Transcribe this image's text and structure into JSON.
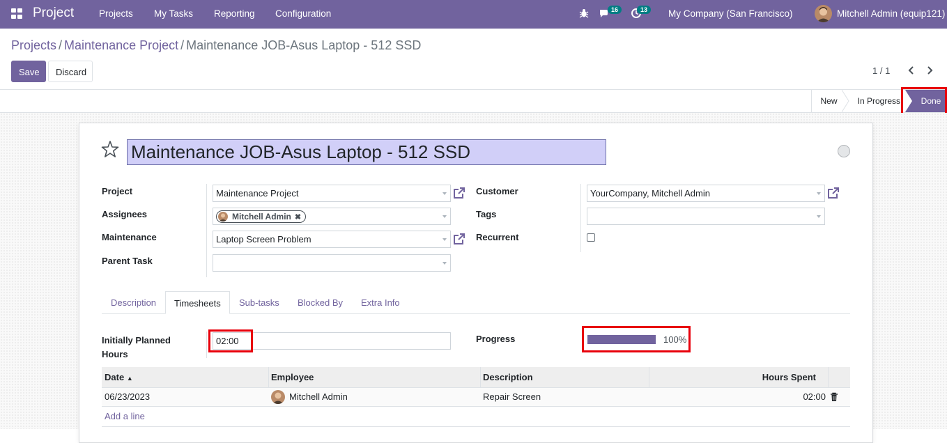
{
  "navbar": {
    "app_title": "Project",
    "menu": [
      "Projects",
      "My Tasks",
      "Reporting",
      "Configuration"
    ],
    "messages_count": "16",
    "activities_count": "13",
    "company": "My Company (San Francisco)",
    "user": "Mitchell Admin (equip121)"
  },
  "breadcrumb": {
    "items": [
      "Projects",
      "Maintenance Project"
    ],
    "current": "Maintenance JOB-Asus Laptop - 512 SSD"
  },
  "buttons": {
    "save": "Save",
    "discard": "Discard"
  },
  "pager": {
    "value": "1 / 1"
  },
  "stages": {
    "new": "New",
    "in_progress": "In Progress",
    "done": "Done",
    "active": "Done"
  },
  "task": {
    "title": "Maintenance JOB-Asus Laptop - 512 SSD",
    "fields": {
      "project_label": "Project",
      "project_value": "Maintenance Project",
      "assignees_label": "Assignees",
      "assignee_tag": "Mitchell Admin",
      "maintenance_label": "Maintenance",
      "maintenance_value": "Laptop Screen Problem",
      "parent_task_label": "Parent Task",
      "parent_task_value": "",
      "customer_label": "Customer",
      "customer_value": "YourCompany, Mitchell Admin",
      "tags_label": "Tags",
      "tags_value": "",
      "recurrent_label": "Recurrent",
      "recurrent_checked": false
    }
  },
  "tabs": [
    "Description",
    "Timesheets",
    "Sub-tasks",
    "Blocked By",
    "Extra Info"
  ],
  "active_tab": "Timesheets",
  "timesheets": {
    "planned_label_line1": "Initially Planned",
    "planned_label_line2": "Hours",
    "planned_value": "02:00",
    "progress_label": "Progress",
    "progress_value": 1.0,
    "progress_text": "100%",
    "columns": [
      "Date",
      "Employee",
      "Description",
      "Hours Spent"
    ],
    "rows": [
      {
        "date": "06/23/2023",
        "employee": "Mitchell Admin",
        "description": "Repair Screen",
        "hours": "02:00"
      }
    ],
    "add_line": "Add a line"
  },
  "colors": {
    "brand": "#71639e",
    "badge": "#017e84",
    "highlight": "#e8000b"
  }
}
